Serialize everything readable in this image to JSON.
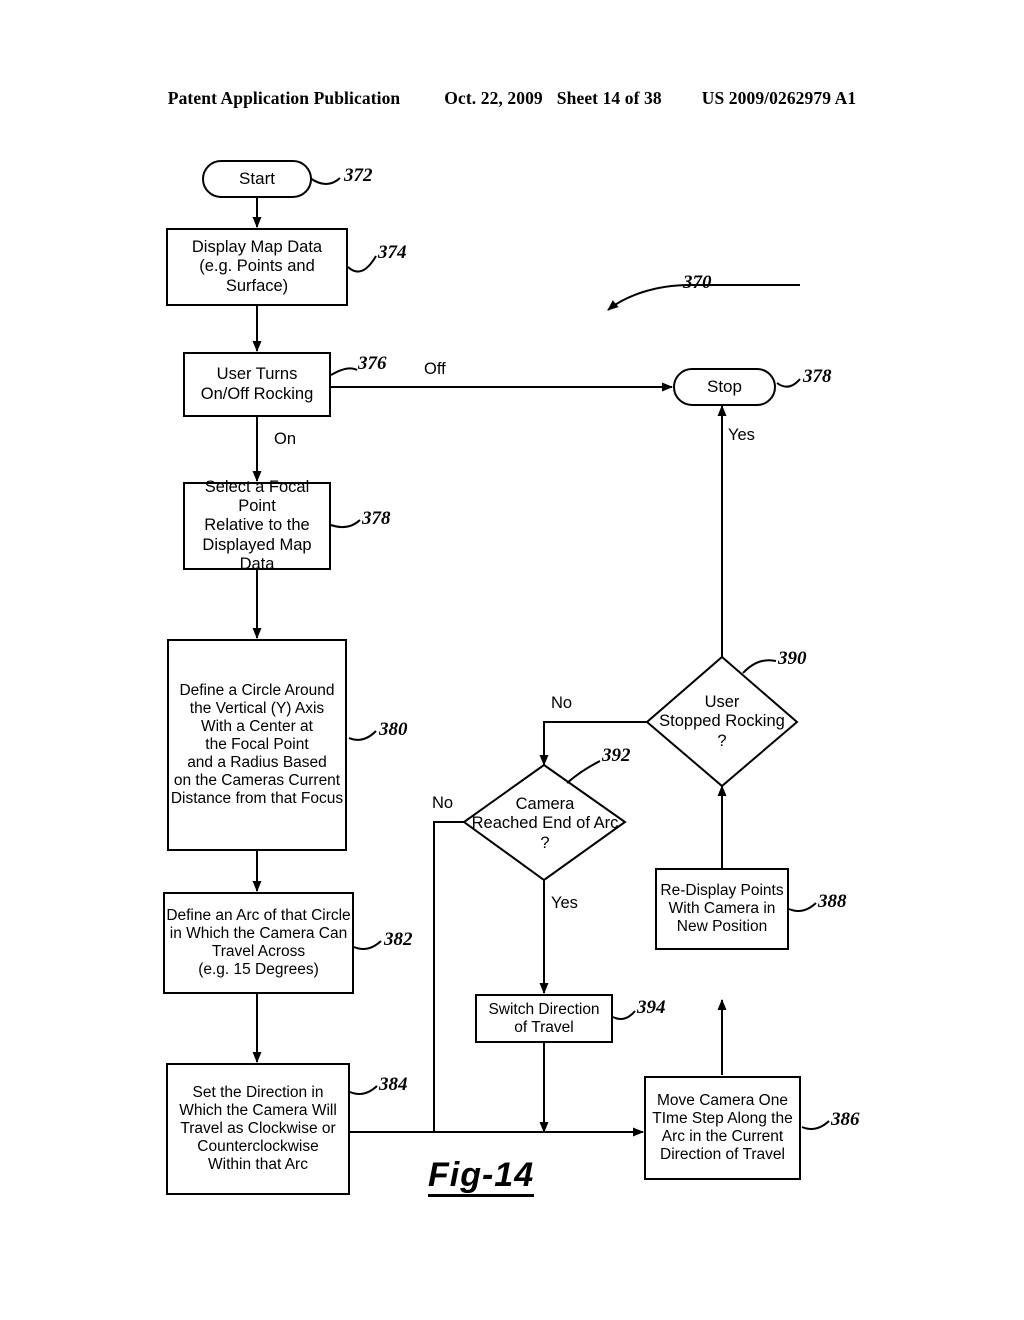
{
  "header": {
    "publication": "Patent Application Publication",
    "date": "Oct. 22, 2009",
    "sheet": "Sheet 14 of 38",
    "patent_number": "US 2009/0262979 A1"
  },
  "figure": {
    "caption": "Fig-14",
    "diagram_ref": "370"
  },
  "nodes": {
    "start": {
      "label": "Start",
      "ref": "372",
      "shape": "terminal"
    },
    "display_map": {
      "label": "Display Map Data\n(e.g. Points and Surface)",
      "ref": "374",
      "shape": "process"
    },
    "user_turns": {
      "label": "User Turns\nOn/Off Rocking",
      "ref": "376",
      "shape": "process"
    },
    "stop": {
      "label": "Stop",
      "ref": "378",
      "shape": "terminal"
    },
    "select_focal": {
      "label": "Select a Focal Point\nRelative to the\nDisplayed Map Data",
      "ref": "378",
      "shape": "process"
    },
    "define_circle": {
      "label": "Define a Circle Around\nthe Vertical (Y) Axis\nWith a Center at\nthe Focal Point\nand a Radius Based\non the Cameras Current\nDistance from that Focus",
      "ref": "380",
      "shape": "process"
    },
    "define_arc": {
      "label": "Define an Arc of that Circle\nin Which the Camera Can\nTravel Across\n(e.g. 15 Degrees)",
      "ref": "382",
      "shape": "process"
    },
    "set_direction": {
      "label": "Set the Direction in\nWhich the Camera Will\nTravel as Clockwise or\nCounterclockwise\nWithin that Arc",
      "ref": "384",
      "shape": "process"
    },
    "move_camera": {
      "label": "Move Camera One\nTIme Step Along the\nArc in the Current\nDirection of Travel",
      "ref": "386",
      "shape": "process"
    },
    "redisplay": {
      "label": "Re-Display Points\nWith Camera in\nNew Position",
      "ref": "388",
      "shape": "process"
    },
    "user_stopped": {
      "label": "User\nStopped Rocking\n?",
      "ref": "390",
      "shape": "decision"
    },
    "reached_end": {
      "label": "Camera\nReached End of Arc\n?",
      "ref": "392",
      "shape": "decision"
    },
    "switch_direction": {
      "label": "Switch Direction\nof Travel",
      "ref": "394",
      "shape": "process"
    }
  },
  "edges": {
    "off": "Off",
    "on": "On",
    "yes_stop": "Yes",
    "no_stopped": "No",
    "no_reached": "No",
    "yes_reached": "Yes"
  }
}
